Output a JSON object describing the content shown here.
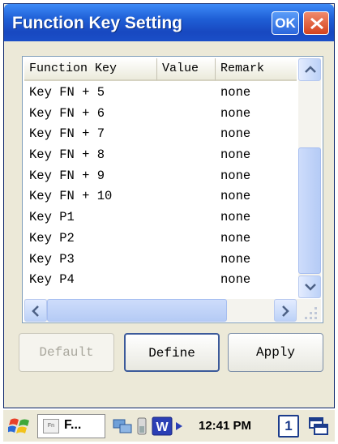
{
  "window": {
    "title": "Function Key Setting",
    "ok_label": "OK"
  },
  "listview": {
    "columns": [
      "Function Key",
      "Value",
      "Remark"
    ],
    "rows": [
      {
        "key": "Key FN + 5",
        "value": "",
        "remark": "none"
      },
      {
        "key": "Key FN + 6",
        "value": "",
        "remark": "none"
      },
      {
        "key": "Key FN + 7",
        "value": "",
        "remark": "none"
      },
      {
        "key": "Key FN + 8",
        "value": "",
        "remark": "none"
      },
      {
        "key": "Key FN + 9",
        "value": "",
        "remark": "none"
      },
      {
        "key": "Key FN + 10",
        "value": "",
        "remark": "none"
      },
      {
        "key": "Key P1",
        "value": "",
        "remark": "none"
      },
      {
        "key": "Key P2",
        "value": "",
        "remark": "none"
      },
      {
        "key": "Key P3",
        "value": "",
        "remark": "none"
      },
      {
        "key": "Key P4",
        "value": "",
        "remark": "none"
      }
    ]
  },
  "buttons": {
    "default_label": "Default",
    "define_label": "Define",
    "apply_label": "Apply"
  },
  "taskbar": {
    "task_label": "F...",
    "task_icon_text": "Fn",
    "clock": "12:41 PM",
    "input_panel_label": "1"
  },
  "colors": {
    "titlebar": "#1f5fd6",
    "close": "#d4431e",
    "scrollbar": "#bcd1f7"
  }
}
